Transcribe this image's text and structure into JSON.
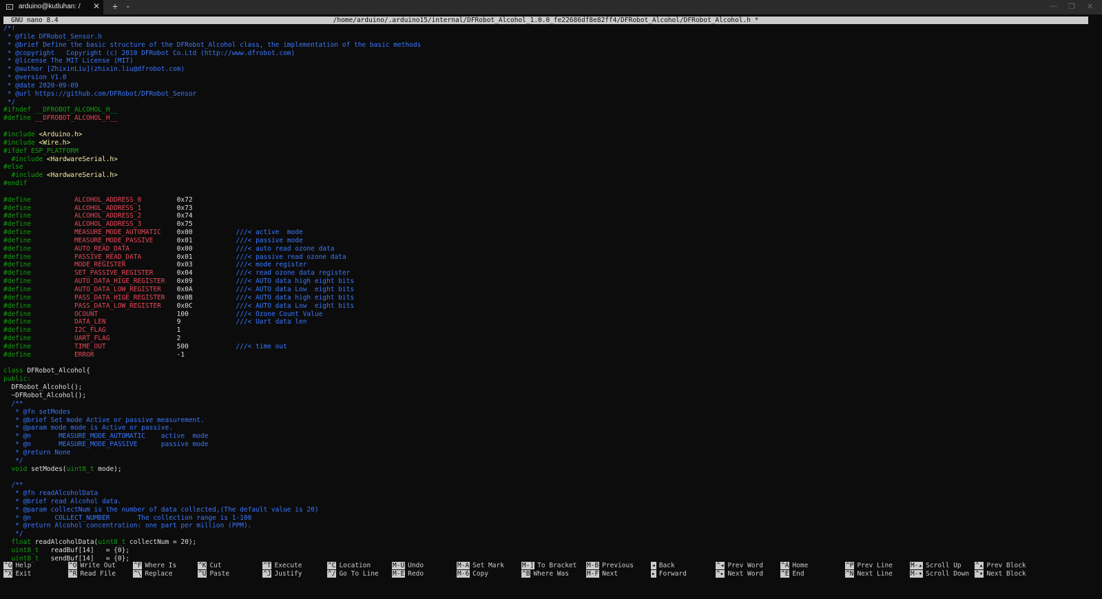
{
  "window": {
    "tab_title": "arduino@kutluhan: /",
    "tab_close": "✕",
    "new_tab": "+",
    "tab_dropdown": "⌄",
    "minimize": "—",
    "maximize": "❐",
    "close": "✕"
  },
  "nano": {
    "version": "GNU nano 8.4",
    "filepath": "/home/arduino/.arduino15/internal/DFRobot_Alcohol_1.0.0_fe22686df8e82ff4/DFRobot_Alcohol/DFRobot_Alcohol.h *"
  },
  "colors": {
    "background": "#0c0c0c",
    "doc_comment": "#3b78ff",
    "preprocessor": "#13a10e",
    "macro": "#e74856",
    "string_include": "#f9f1a5",
    "header_bg": "#cccccc"
  },
  "code_lines": [
    [
      {
        "t": "/*!",
        "c": "doc"
      }
    ],
    [
      {
        "t": " * @file DFRobot_Sensor.h",
        "c": "doc"
      }
    ],
    [
      {
        "t": " * @brief Define the basic structure of the DFRobot_Alcohol class, the implementation of the basic methods",
        "c": "doc"
      }
    ],
    [
      {
        "t": " * @copyright   Copyright (c) 2010 DFRobot Co.Ltd (http://www.dfrobot.com)",
        "c": "doc"
      }
    ],
    [
      {
        "t": " * @license The MIT License (MIT)",
        "c": "doc"
      }
    ],
    [
      {
        "t": " * @author [ZhixinLiu](zhixin.liu@dfrobot.com)",
        "c": "doc"
      }
    ],
    [
      {
        "t": " * @version V1.0",
        "c": "doc"
      }
    ],
    [
      {
        "t": " * @date 2020-09-09",
        "c": "doc"
      }
    ],
    [
      {
        "t": " * @url https://github.com/DFRobot/DFRobot_Sensor",
        "c": "doc"
      }
    ],
    [
      {
        "t": " */",
        "c": "doc"
      }
    ],
    [
      {
        "t": "#ifndef __DFROBOT_ALCOHOL_H__",
        "c": "pp"
      }
    ],
    [
      {
        "t": "#define ",
        "c": "pp"
      },
      {
        "t": "__DFROBOT_ALCOHOL_H__",
        "c": "red"
      }
    ],
    [
      {
        "t": "",
        "c": "txt"
      }
    ],
    [
      {
        "t": "#include ",
        "c": "pp"
      },
      {
        "t": "<Arduino.h>",
        "c": "y"
      }
    ],
    [
      {
        "t": "#include ",
        "c": "pp"
      },
      {
        "t": "<Wire.h>",
        "c": "y"
      }
    ],
    [
      {
        "t": "#ifdef ESP_PLATFORM",
        "c": "pp"
      }
    ],
    [
      {
        "t": "  #include ",
        "c": "pp"
      },
      {
        "t": "<HardwareSerial.h>",
        "c": "y"
      }
    ],
    [
      {
        "t": "#else",
        "c": "pp"
      }
    ],
    [
      {
        "t": "  #include ",
        "c": "pp"
      },
      {
        "t": "<HardwareSerial.h>",
        "c": "y"
      }
    ],
    [
      {
        "t": "#endif",
        "c": "pp"
      }
    ],
    [
      {
        "t": "",
        "c": "txt"
      }
    ],
    [
      {
        "t": "#define           ",
        "c": "pp"
      },
      {
        "t": "ALCOHOL_ADDRESS_0         ",
        "c": "red"
      },
      {
        "t": "0x72",
        "c": "txt"
      }
    ],
    [
      {
        "t": "#define           ",
        "c": "pp"
      },
      {
        "t": "ALCOHOL_ADDRESS_1         ",
        "c": "red"
      },
      {
        "t": "0x73",
        "c": "txt"
      }
    ],
    [
      {
        "t": "#define           ",
        "c": "pp"
      },
      {
        "t": "ALCOHOL_ADDRESS_2         ",
        "c": "red"
      },
      {
        "t": "0x74",
        "c": "txt"
      }
    ],
    [
      {
        "t": "#define           ",
        "c": "pp"
      },
      {
        "t": "ALCOHOL_ADDRESS_3         ",
        "c": "red"
      },
      {
        "t": "0x75",
        "c": "txt"
      }
    ],
    [
      {
        "t": "#define           ",
        "c": "pp"
      },
      {
        "t": "MEASURE_MODE_AUTOMATIC    ",
        "c": "red"
      },
      {
        "t": "0x00           ",
        "c": "txt"
      },
      {
        "t": "///< active  mode",
        "c": "doc"
      }
    ],
    [
      {
        "t": "#define           ",
        "c": "pp"
      },
      {
        "t": "MEASURE_MODE_PASSIVE      ",
        "c": "red"
      },
      {
        "t": "0x01           ",
        "c": "txt"
      },
      {
        "t": "///< passive mode",
        "c": "doc"
      }
    ],
    [
      {
        "t": "#define           ",
        "c": "pp"
      },
      {
        "t": "AUTO_READ_DATA            ",
        "c": "red"
      },
      {
        "t": "0x00           ",
        "c": "txt"
      },
      {
        "t": "///< auto read ozone data",
        "c": "doc"
      }
    ],
    [
      {
        "t": "#define           ",
        "c": "pp"
      },
      {
        "t": "PASSIVE_READ_DATA         ",
        "c": "red"
      },
      {
        "t": "0x01           ",
        "c": "txt"
      },
      {
        "t": "///< passive read ozone data",
        "c": "doc"
      }
    ],
    [
      {
        "t": "#define           ",
        "c": "pp"
      },
      {
        "t": "MODE_REGISTER             ",
        "c": "red"
      },
      {
        "t": "0x03           ",
        "c": "txt"
      },
      {
        "t": "///< mode register",
        "c": "doc"
      }
    ],
    [
      {
        "t": "#define           ",
        "c": "pp"
      },
      {
        "t": "SET_PASSIVE_REGISTER      ",
        "c": "red"
      },
      {
        "t": "0x04           ",
        "c": "txt"
      },
      {
        "t": "///< read ozone data register",
        "c": "doc"
      }
    ],
    [
      {
        "t": "#define           ",
        "c": "pp"
      },
      {
        "t": "AUTO_DATA_HIGE_REGISTER   ",
        "c": "red"
      },
      {
        "t": "0x09           ",
        "c": "txt"
      },
      {
        "t": "///< AUTO data high eight bits",
        "c": "doc"
      }
    ],
    [
      {
        "t": "#define           ",
        "c": "pp"
      },
      {
        "t": "AUTO_DATA_LOW_REGISTER    ",
        "c": "red"
      },
      {
        "t": "0x0A           ",
        "c": "txt"
      },
      {
        "t": "///< AUTO data Low  eight bits",
        "c": "doc"
      }
    ],
    [
      {
        "t": "#define           ",
        "c": "pp"
      },
      {
        "t": "PASS_DATA_HIGE_REGISTER   ",
        "c": "red"
      },
      {
        "t": "0x0B           ",
        "c": "txt"
      },
      {
        "t": "///< AUTO data high eight bits",
        "c": "doc"
      }
    ],
    [
      {
        "t": "#define           ",
        "c": "pp"
      },
      {
        "t": "PASS_DATA_LOW_REGISTER    ",
        "c": "red"
      },
      {
        "t": "0x0C           ",
        "c": "txt"
      },
      {
        "t": "///< AUTO data Low  eight bits",
        "c": "doc"
      }
    ],
    [
      {
        "t": "#define           ",
        "c": "pp"
      },
      {
        "t": "OCOUNT                    ",
        "c": "red"
      },
      {
        "t": "100            ",
        "c": "txt"
      },
      {
        "t": "///< Ozone Count Value",
        "c": "doc"
      }
    ],
    [
      {
        "t": "#define           ",
        "c": "pp"
      },
      {
        "t": "DATA_LEN                  ",
        "c": "red"
      },
      {
        "t": "9              ",
        "c": "txt"
      },
      {
        "t": "///< Uart data len",
        "c": "doc"
      }
    ],
    [
      {
        "t": "#define           ",
        "c": "pp"
      },
      {
        "t": "I2C_FLAG                  ",
        "c": "red"
      },
      {
        "t": "1",
        "c": "txt"
      }
    ],
    [
      {
        "t": "#define           ",
        "c": "pp"
      },
      {
        "t": "UART_FLAG                 ",
        "c": "red"
      },
      {
        "t": "2",
        "c": "txt"
      }
    ],
    [
      {
        "t": "#define           ",
        "c": "pp"
      },
      {
        "t": "TIME_OUT                  ",
        "c": "red"
      },
      {
        "t": "500            ",
        "c": "txt"
      },
      {
        "t": "///< time out",
        "c": "doc"
      }
    ],
    [
      {
        "t": "#define           ",
        "c": "pp"
      },
      {
        "t": "ERROR                     ",
        "c": "red"
      },
      {
        "t": "-1",
        "c": "txt"
      }
    ],
    [
      {
        "t": "",
        "c": "txt"
      }
    ],
    [
      {
        "t": "class ",
        "c": "grn"
      },
      {
        "t": "DFRobot_Alcohol{",
        "c": "txt"
      }
    ],
    [
      {
        "t": "public:",
        "c": "grn"
      }
    ],
    [
      {
        "t": "  DFRobot_Alcohol();",
        "c": "txt"
      }
    ],
    [
      {
        "t": "  ~DFRobot_Alcohol();",
        "c": "txt"
      }
    ],
    [
      {
        "t": "  /**",
        "c": "doc"
      }
    ],
    [
      {
        "t": "   * @fn setModes",
        "c": "doc"
      }
    ],
    [
      {
        "t": "   * @brief Set mode Active or passive measurement.",
        "c": "doc"
      }
    ],
    [
      {
        "t": "   * @param mode mode is Active or passive.",
        "c": "doc"
      }
    ],
    [
      {
        "t": "   * @n       MEASURE_MODE_AUTOMATIC    active  mode",
        "c": "doc"
      }
    ],
    [
      {
        "t": "   * @n       MEASURE_MODE_PASSIVE      passive mode",
        "c": "doc"
      }
    ],
    [
      {
        "t": "   * @return None",
        "c": "doc"
      }
    ],
    [
      {
        "t": "   */",
        "c": "doc"
      }
    ],
    [
      {
        "t": "  void ",
        "c": "grn"
      },
      {
        "t": "setModes(",
        "c": "txt"
      },
      {
        "t": "uint8_t",
        "c": "grn"
      },
      {
        "t": " mode);",
        "c": "txt"
      }
    ],
    [
      {
        "t": "",
        "c": "txt"
      }
    ],
    [
      {
        "t": "  /**",
        "c": "doc"
      }
    ],
    [
      {
        "t": "   * @fn readAlcoholData",
        "c": "doc"
      }
    ],
    [
      {
        "t": "   * @brief read Alcohol data.",
        "c": "doc"
      }
    ],
    [
      {
        "t": "   * @param collectNum is the number of data collected,(The default value is 20)",
        "c": "doc"
      }
    ],
    [
      {
        "t": "   * @n      COLLECT_NUMBER       The collection range is 1-100",
        "c": "doc"
      }
    ],
    [
      {
        "t": "   * @return Alcohol concentration: one part per million (PPM).",
        "c": "doc"
      }
    ],
    [
      {
        "t": "   */",
        "c": "doc"
      }
    ],
    [
      {
        "t": "  float ",
        "c": "grn"
      },
      {
        "t": "readAlcoholData(",
        "c": "txt"
      },
      {
        "t": "uint8_t",
        "c": "grn"
      },
      {
        "t": " collectNum = 20);",
        "c": "txt"
      }
    ],
    [
      {
        "t": "  uint8_t",
        "c": "grn"
      },
      {
        "t": "   readBuf[14]   = {0};",
        "c": "txt"
      }
    ],
    [
      {
        "t": "  uint8_t",
        "c": "grn"
      },
      {
        "t": "   sendBuf[14]   = {0};",
        "c": "txt"
      }
    ]
  ],
  "shortcuts": [
    {
      "k1": "^G",
      "l1": "Help",
      "k2": "^X",
      "l2": "Exit"
    },
    {
      "k1": "^O",
      "l1": "Write Out",
      "k2": "^R",
      "l2": "Read File"
    },
    {
      "k1": "^F",
      "l1": "Where Is",
      "k2": "^\\",
      "l2": "Replace"
    },
    {
      "k1": "^K",
      "l1": "Cut",
      "k2": "^U",
      "l2": "Paste"
    },
    {
      "k1": "^T",
      "l1": "Execute",
      "k2": "^J",
      "l2": "Justify"
    },
    {
      "k1": "^C",
      "l1": "Location",
      "k2": "^/",
      "l2": "Go To Line"
    },
    {
      "k1": "M-U",
      "l1": "Undo",
      "k2": "M-E",
      "l2": "Redo"
    },
    {
      "k1": "M-A",
      "l1": "Set Mark",
      "k2": "M-6",
      "l2": "Copy"
    },
    {
      "k1": "M-]",
      "l1": "To Bracket",
      "k2": "^B",
      "l2": "Where Was"
    },
    {
      "k1": "M-B",
      "l1": "Previous",
      "k2": "M-F",
      "l2": "Next"
    },
    {
      "k1": "◂",
      "l1": "Back",
      "k2": "▸",
      "l2": "Forward"
    },
    {
      "k1": "^◂",
      "l1": "Prev Word",
      "k2": "^▸",
      "l2": "Next Word"
    },
    {
      "k1": "^A",
      "l1": "Home",
      "k2": "^E",
      "l2": "End"
    },
    {
      "k1": "^P",
      "l1": "Prev Line",
      "k2": "^N",
      "l2": "Next Line"
    },
    {
      "k1": "M-▴",
      "l1": "Scroll Up",
      "k2": "M-▾",
      "l2": "Scroll Down"
    },
    {
      "k1": "^▴",
      "l1": "Prev Block",
      "k2": "^▾",
      "l2": "Next Block"
    }
  ]
}
